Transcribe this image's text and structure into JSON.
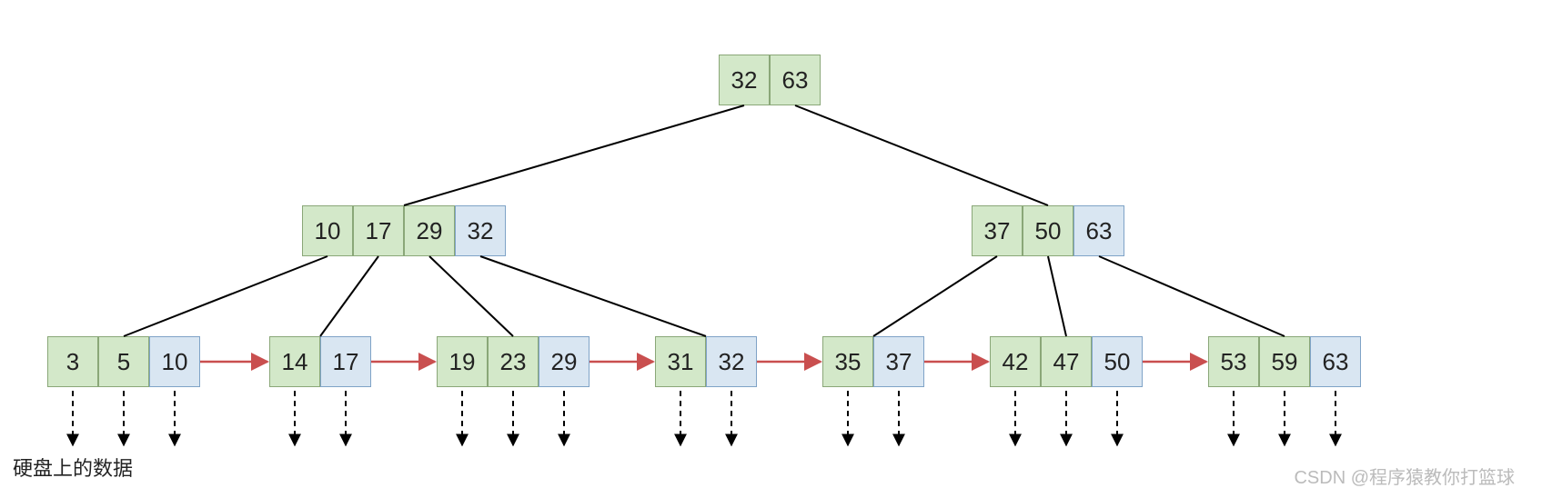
{
  "tree": {
    "root": {
      "cells": [
        "32",
        "63"
      ],
      "colors": [
        "green",
        "green"
      ]
    },
    "level1": [
      {
        "cells": [
          "10",
          "17",
          "29",
          "32"
        ],
        "colors": [
          "green",
          "green",
          "green",
          "blue"
        ]
      },
      {
        "cells": [
          "37",
          "50",
          "63"
        ],
        "colors": [
          "green",
          "green",
          "blue"
        ]
      }
    ],
    "leaves": [
      {
        "cells": [
          "3",
          "5",
          "10"
        ],
        "colors": [
          "green",
          "green",
          "blue"
        ]
      },
      {
        "cells": [
          "14",
          "17"
        ],
        "colors": [
          "green",
          "blue"
        ]
      },
      {
        "cells": [
          "19",
          "23",
          "29"
        ],
        "colors": [
          "green",
          "green",
          "blue"
        ]
      },
      {
        "cells": [
          "31",
          "32"
        ],
        "colors": [
          "green",
          "blue"
        ]
      },
      {
        "cells": [
          "35",
          "37"
        ],
        "colors": [
          "green",
          "blue"
        ]
      },
      {
        "cells": [
          "42",
          "47",
          "50"
        ],
        "colors": [
          "green",
          "green",
          "blue"
        ]
      },
      {
        "cells": [
          "53",
          "59",
          "63"
        ],
        "colors": [
          "green",
          "green",
          "blue"
        ]
      }
    ]
  },
  "labels": {
    "bottom_left": "硬盘上的数据",
    "watermark": "CSDN @程序猿教你打篮球"
  },
  "colors": {
    "green": "#d3e8c9",
    "blue": "#d9e6f2",
    "arrow": "#c94f4f"
  }
}
